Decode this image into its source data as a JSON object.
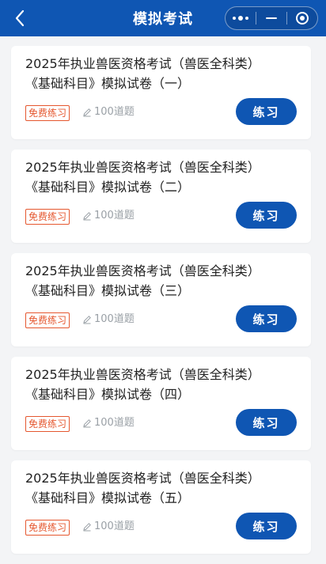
{
  "header": {
    "title": "模拟考试",
    "back_icon": "chevron-left-icon",
    "capsule_icons": [
      "more-dots-icon",
      "minimize-icon",
      "target-icon"
    ]
  },
  "colors": {
    "primary": "#0f56b3",
    "badge": "#e5572f",
    "muted": "#9aa0a6",
    "background": "#f3f4f6"
  },
  "exams": [
    {
      "title_line1": "2025年执业兽医资格考试（兽医全科类）",
      "title_line2": "《基础科目》模拟试卷（一）",
      "badge": "免费练习",
      "count": "100道题",
      "action": "练习"
    },
    {
      "title_line1": "2025年执业兽医资格考试（兽医全科类）",
      "title_line2": "《基础科目》模拟试卷（二）",
      "badge": "免费练习",
      "count": "100道题",
      "action": "练习"
    },
    {
      "title_line1": "2025年执业兽医资格考试（兽医全科类）",
      "title_line2": "《基础科目》模拟试卷（三）",
      "badge": "免费练习",
      "count": "100道题",
      "action": "练习"
    },
    {
      "title_line1": "2025年执业兽医资格考试（兽医全科类）",
      "title_line2": "《基础科目》模拟试卷（四）",
      "badge": "免费练习",
      "count": "100道题",
      "action": "练习"
    },
    {
      "title_line1": "2025年执业兽医资格考试（兽医全科类）",
      "title_line2": "《基础科目》模拟试卷（五）",
      "badge": "免费练习",
      "count": "100道题",
      "action": "练习"
    }
  ]
}
